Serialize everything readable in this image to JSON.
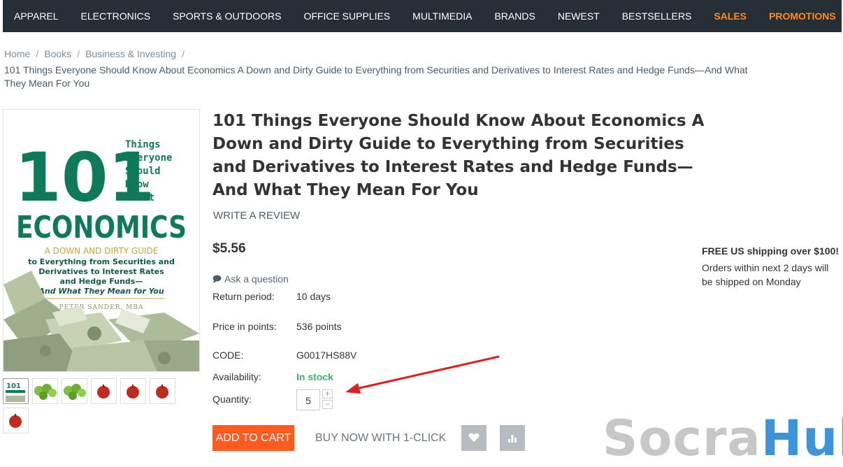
{
  "nav": {
    "items": [
      {
        "label": "APPAREL"
      },
      {
        "label": "ELECTRONICS"
      },
      {
        "label": "SPORTS & OUTDOORS"
      },
      {
        "label": "OFFICE SUPPLIES"
      },
      {
        "label": "MULTIMEDIA"
      },
      {
        "label": "BRANDS"
      },
      {
        "label": "NEWEST"
      },
      {
        "label": "BESTSELLERS"
      },
      {
        "label": "SALES"
      },
      {
        "label": "PROMOTIONS"
      }
    ]
  },
  "breadcrumb": {
    "home": "Home",
    "books": "Books",
    "category": "Business & Investing",
    "current": "101 Things Everyone Should Know About Economics A Down and Dirty Guide to Everything from Securities and Derivatives to Interest Rates and Hedge Funds—And What They Mean For You"
  },
  "product": {
    "title": "101 Things Everyone Should Know About Economics A Down and Dirty Guide to Everything from Securities and Derivatives to Interest Rates and Hedge Funds—And What They Mean For You",
    "write_review": "WRITE A REVIEW",
    "price": "$5.56",
    "ask_question": "Ask a question",
    "return_label": "Return period:",
    "return_value": "10 days",
    "points_label": "Price in points:",
    "points_value": "536 points",
    "code_label": "CODE:",
    "code_value": "G0017HS88V",
    "availability_label": "Availability:",
    "availability_value": "In stock",
    "quantity_label": "Quantity:",
    "quantity_value": "5",
    "add_to_cart": "ADD TO CART",
    "buy_now": "BUY NOW WITH 1-CLICK"
  },
  "cover": {
    "number": "101",
    "things_lines": [
      "Things",
      "Everyone",
      "Should",
      "Know",
      "about"
    ],
    "title": "ECONOMICS",
    "subtitle1": "A DOWN AND DIRTY GUIDE",
    "subtitle2": "to Everything from Securities and",
    "subtitle3": "Derivatives to Interest Rates",
    "subtitle4": "and Hedge Funds—",
    "subtitle5": "And What They Mean for You",
    "author": "PETER SANDER, MBA"
  },
  "shipping": {
    "title": "FREE US shipping over $100!",
    "text": "Orders within next 2 days will be shipped on Monday"
  },
  "watermark": {
    "part1": "Socra",
    "part2": "Hub"
  },
  "colors": {
    "nav_bg": "#262e36",
    "accent": "#ff8a1f",
    "cart": "#ff5a1f",
    "instock": "#3cb371",
    "arrow": "#e02020"
  }
}
